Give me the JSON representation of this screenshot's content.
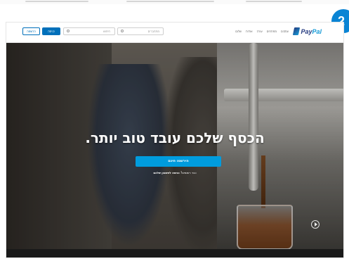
{
  "badge": {
    "number": "2"
  },
  "navbar": {
    "logo_left": "Pay",
    "logo_right": "Pal",
    "links": [
      "עסקים",
      "מפתחים",
      "עזרה",
      "אודות",
      "שלום"
    ],
    "signup_label": "הרשמה",
    "login_label": "כניסה",
    "search_a_placeholder": "חיפוש",
    "search_b_placeholder": "מתחברים"
  },
  "hero": {
    "headline": "הכסף שלכם עובד טוב יותר.",
    "cta_label": "הירשמו חינם",
    "sub_prefix": "כבר רשומים?",
    "sub_link": "כניסה לחשבון שלכם"
  },
  "colors": {
    "brand_dark": "#253b80",
    "brand_light": "#179bd7",
    "cta": "#009cde",
    "badge": "#0a84d4"
  }
}
